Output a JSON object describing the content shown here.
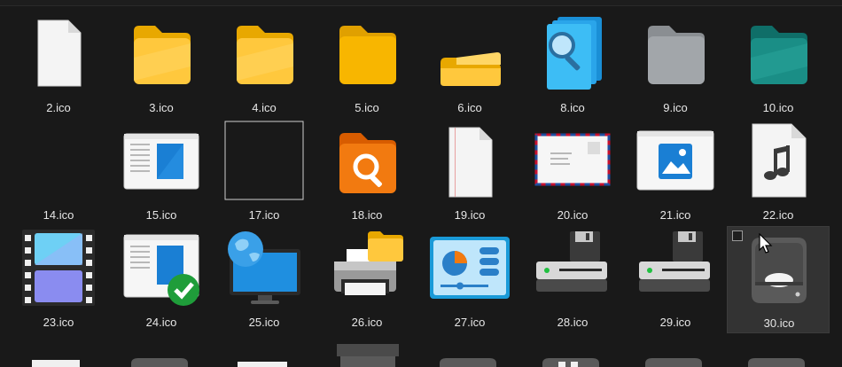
{
  "files": [
    {
      "label": "2.ico",
      "icon": "blank-document-icon"
    },
    {
      "label": "3.ico",
      "icon": "yellow-folder-icon"
    },
    {
      "label": "4.ico",
      "icon": "yellow-folder-icon"
    },
    {
      "label": "5.ico",
      "icon": "yellow-folder-closed-icon"
    },
    {
      "label": "6.ico",
      "icon": "yellow-folder-small-icon"
    },
    {
      "label": "8.ico",
      "icon": "search-documents-icon"
    },
    {
      "label": "9.ico",
      "icon": "gray-folder-icon"
    },
    {
      "label": "10.ico",
      "icon": "teal-folder-icon"
    },
    {
      "label": "14.ico",
      "icon": "empty-icon"
    },
    {
      "label": "15.ico",
      "icon": "window-document-icon"
    },
    {
      "label": "17.ico",
      "icon": "outline-frame-icon"
    },
    {
      "label": "18.ico",
      "icon": "orange-search-folder-icon"
    },
    {
      "label": "19.ico",
      "icon": "lined-document-icon"
    },
    {
      "label": "20.ico",
      "icon": "airmail-envelope-icon"
    },
    {
      "label": "21.ico",
      "icon": "picture-window-icon"
    },
    {
      "label": "22.ico",
      "icon": "music-document-icon"
    },
    {
      "label": "23.ico",
      "icon": "film-strip-icon"
    },
    {
      "label": "24.ico",
      "icon": "window-check-icon"
    },
    {
      "label": "25.ico",
      "icon": "globe-monitor-icon"
    },
    {
      "label": "26.ico",
      "icon": "printer-folder-icon"
    },
    {
      "label": "27.ico",
      "icon": "control-panel-icon"
    },
    {
      "label": "28.ico",
      "icon": "floppy-drive-icon"
    },
    {
      "label": "29.ico",
      "icon": "floppy-drive-icon"
    },
    {
      "label": "30.ico",
      "icon": "hard-drive-icon"
    }
  ],
  "colors": {
    "background": "#191919",
    "selection": "#333333",
    "text": "#e6e6e6"
  }
}
